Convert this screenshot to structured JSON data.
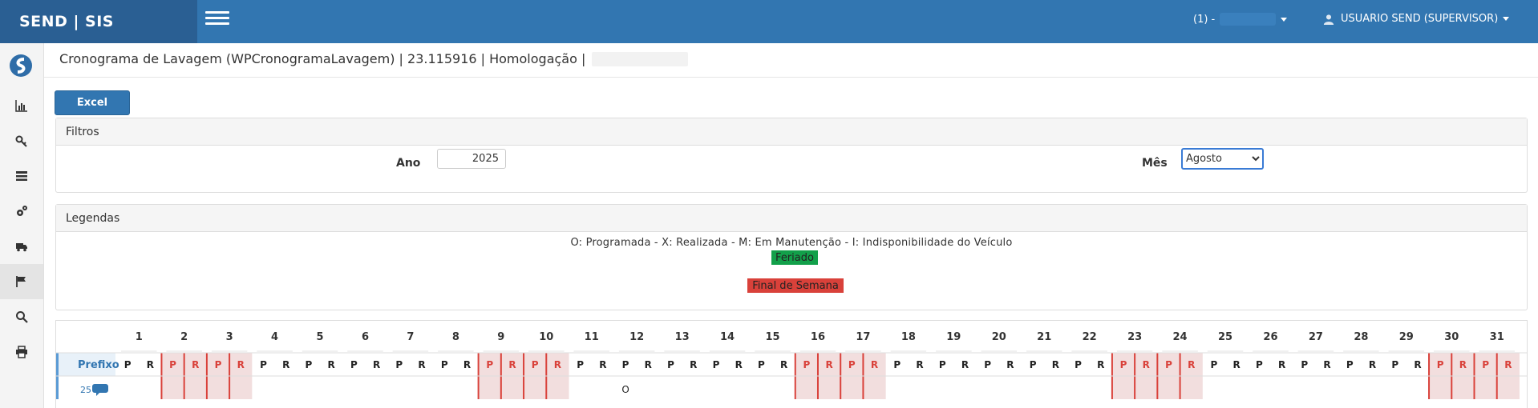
{
  "brand": {
    "title": "SEND | SIS"
  },
  "header": {
    "unit_label": "(1) -",
    "user_label": "USUARIO SEND (SUPERVISOR)"
  },
  "sidebar": {
    "items": [
      {
        "icon": "bar-chart-icon"
      },
      {
        "icon": "key-icon"
      },
      {
        "icon": "list-icon"
      },
      {
        "icon": "gears-icon"
      },
      {
        "icon": "truck-icon"
      },
      {
        "icon": "flag-icon"
      },
      {
        "icon": "search-icon"
      },
      {
        "icon": "print-icon"
      }
    ]
  },
  "breadcrumb": {
    "text": "Cronograma de Lavagem (WPCronogramaLavagem) | 23.115916 | Homologação |"
  },
  "toolbar": {
    "excel_label": "Excel"
  },
  "filtros": {
    "title": "Filtros",
    "ano_label": "Ano",
    "ano_value": "2025",
    "mes_label": "Mês",
    "mes_value": "Agosto"
  },
  "legendas": {
    "title": "Legendas",
    "text": "O: Programada - X: Realizada - M: Em Manutenção - I: Indisponibilidade do Veículo",
    "feriado": "Feriado",
    "final_semana": "Final de Semana",
    "colors": {
      "feriado": "#12a04a",
      "final_semana": "#d9413a",
      "weekend_bg": "#f2dede",
      "weekend_text": "#d9413a"
    }
  },
  "grid": {
    "prefixo_label": "Prefixo",
    "days": [
      "1",
      "2",
      "3",
      "4",
      "5",
      "6",
      "7",
      "8",
      "9",
      "10",
      "11",
      "12",
      "13",
      "14",
      "15",
      "16",
      "17",
      "18",
      "19",
      "20",
      "21",
      "22",
      "23",
      "24",
      "25",
      "26",
      "27",
      "28",
      "29",
      "30",
      "31"
    ],
    "weekend_days": [
      2,
      3,
      9,
      10,
      16,
      17,
      23,
      24,
      30,
      31
    ],
    "p_label": "P",
    "r_label": "R",
    "rows": [
      {
        "prefixo": "25",
        "marks": [
          {
            "day": 12,
            "sub": "P",
            "value": "O"
          }
        ]
      }
    ]
  }
}
